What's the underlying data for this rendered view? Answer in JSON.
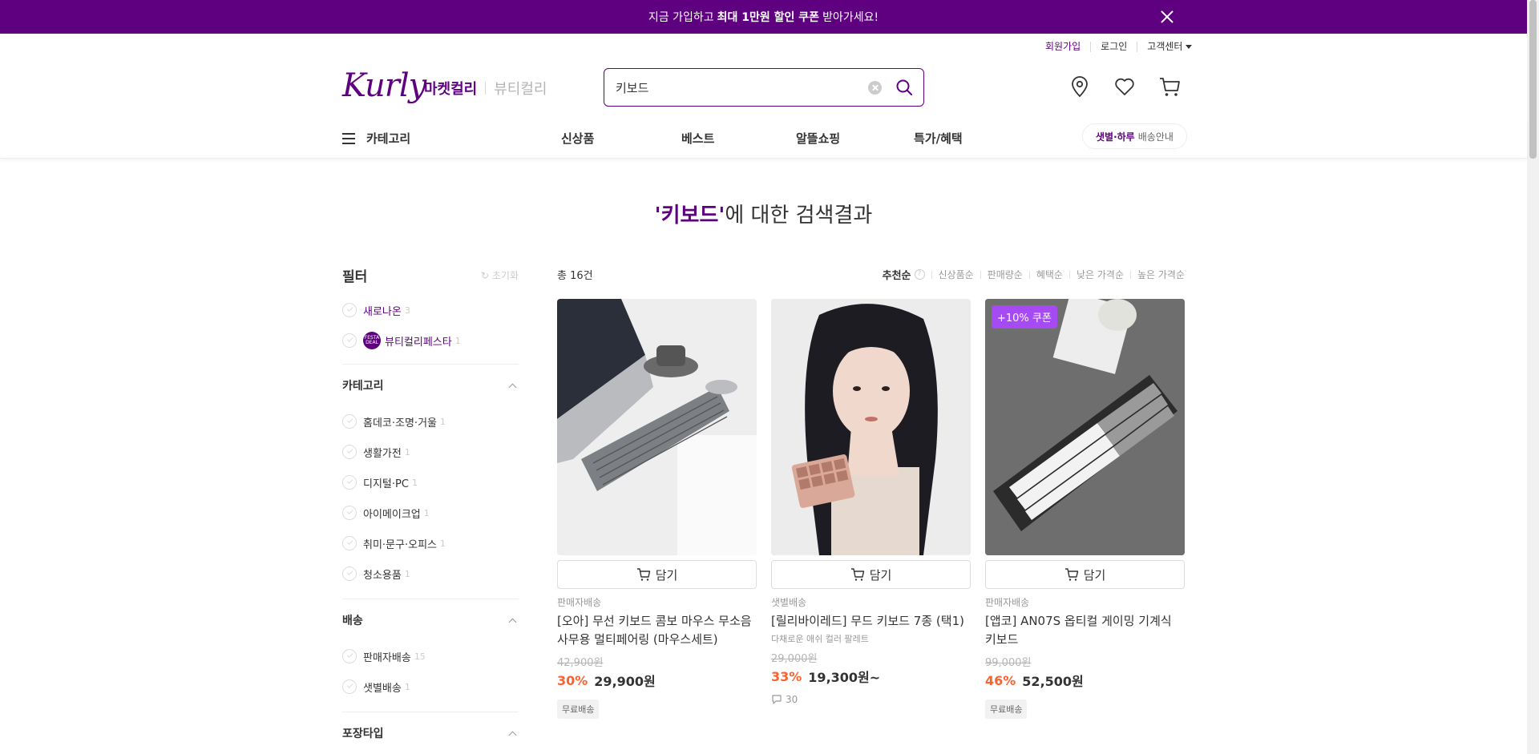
{
  "promo": {
    "pre": "지금 가입하고",
    "bold": "최대 1만원 할인 쿠폰",
    "post": "받아가세요!"
  },
  "user_menu": {
    "signup": "회원가입",
    "login": "로그인",
    "cs": "고객센터"
  },
  "header": {
    "logo": "Kurly",
    "mall_active": "마켓컬리",
    "mall_inactive": "뷰티컬리",
    "search_value": "키보드"
  },
  "gnb": {
    "category": "카테고리",
    "menus": [
      "신상품",
      "베스트",
      "알뜰쇼핑",
      "특가/혜택"
    ],
    "delivery_bold": "샛별·하루",
    "delivery_rest": "배송안내"
  },
  "result": {
    "keyword": "'키보드'",
    "suffix": "에 대한 검색결과"
  },
  "filter": {
    "title": "필터",
    "reset": "초기화",
    "top_items": [
      {
        "label": "새로나온",
        "count": "3"
      },
      {
        "label": "뷰티컬리페스타",
        "count": "1",
        "badge": "FESTA DEAL"
      }
    ],
    "sections": [
      {
        "title": "카테고리",
        "items": [
          {
            "label": "홈데코·조명·거울",
            "count": "1"
          },
          {
            "label": "생활가전",
            "count": "1"
          },
          {
            "label": "디지털·PC",
            "count": "1"
          },
          {
            "label": "아이메이크업",
            "count": "1"
          },
          {
            "label": "취미·문구·오피스",
            "count": "1"
          },
          {
            "label": "청소용품",
            "count": "1"
          }
        ]
      },
      {
        "title": "배송",
        "items": [
          {
            "label": "판매자배송",
            "count": "15"
          },
          {
            "label": "샛별배송",
            "count": "1"
          }
        ]
      },
      {
        "title": "포장타입",
        "items": []
      }
    ]
  },
  "list": {
    "total": "총 16건",
    "sort_active": "추천순",
    "sorts": [
      "신상품순",
      "판매량순",
      "혜택순",
      "낮은 가격순",
      "높은 가격순"
    ]
  },
  "products": [
    {
      "shipping": "판매자배송",
      "name": "[오아] 무선 키보드 콤보 마우스 무소음 사무용 멀티페어링 (마우스세트)",
      "original": "42,900원",
      "rate": "30%",
      "price": "29,900원",
      "tag": "무료배송",
      "cart": "담기"
    },
    {
      "shipping": "샛별배송",
      "name": "[릴리바이레드] 무드 키보드 7종 (택1)",
      "desc": "다채로운 애쉬 컬러 팔레트",
      "original": "29,000원",
      "rate": "33%",
      "price": "19,300원~",
      "reviews": "30",
      "cart": "담기"
    },
    {
      "coupon": "+10% 쿠폰",
      "shipping": "판매자배송",
      "name": "[앱코] AN07S 옵티컬 게이밍 기계식 키보드",
      "original": "99,000원",
      "rate": "46%",
      "price": "52,500원",
      "tag": "무료배송",
      "cart": "담기"
    }
  ],
  "colors": {
    "brand": "#5f0080",
    "discount": "#fa622f",
    "coupon": "#a64bf4"
  }
}
